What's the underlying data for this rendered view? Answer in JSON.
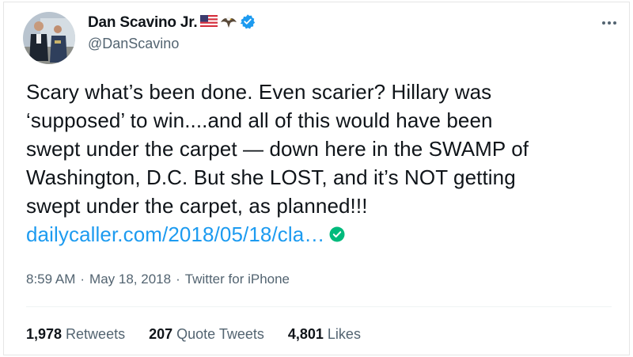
{
  "tweet": {
    "author": {
      "display_name": "Dan Scavino Jr.",
      "handle": "@DanScavino",
      "name_emojis": [
        "us-flag-icon",
        "eagle-icon"
      ],
      "verified": true
    },
    "text_lines": [
      "Scary what’s been done. Even scarier? Hillary was",
      "‘supposed’ to win....and all of this would have been",
      "swept under the carpet — down here in the SWAMP of",
      "Washington, D.C. But she LOST, and it’s NOT getting",
      "swept under the carpet, as planned!!!"
    ],
    "link_text": "dailycaller.com/2018/05/18/cla…",
    "time": "8:59 AM",
    "date": "May 18, 2018",
    "source": "Twitter for iPhone",
    "separator": "·",
    "stats": {
      "retweets": {
        "count": "1,978",
        "label": "Retweets"
      },
      "quote_tweets": {
        "count": "207",
        "label": "Quote Tweets"
      },
      "likes": {
        "count": "4,801",
        "label": "Likes"
      }
    }
  },
  "colors": {
    "link": "#1d9bf0",
    "verified_badge": "#1d9bf0",
    "link_check": "#00ba7c",
    "secondary_text": "#536471"
  }
}
